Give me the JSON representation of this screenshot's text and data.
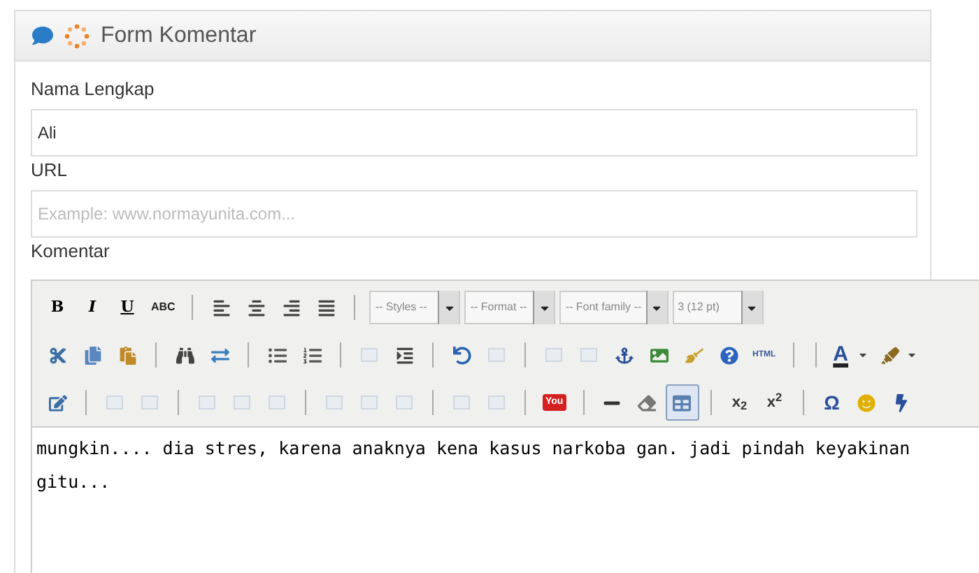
{
  "header": {
    "title": "Form Komentar"
  },
  "fields": [
    {
      "label": "Nama Lengkap",
      "value": "Ali"
    },
    {
      "label": "URL",
      "placeholder": "Example: www.normayunita.com..."
    }
  ],
  "editor": {
    "label": "Komentar",
    "toolbar": [
      [
        {
          "kind": "bold",
          "label": "B",
          "disabled": false,
          "selected": false
        },
        {
          "kind": "italic",
          "label": "I",
          "disabled": false,
          "selected": false
        },
        {
          "kind": "underline",
          "label": "U",
          "disabled": false,
          "selected": false
        },
        {
          "kind": "strike",
          "label": "ABC",
          "disabled": false,
          "selected": false
        },
        {
          "kind": "separator"
        },
        {
          "kind": "align-left",
          "disabled": false,
          "selected": false
        },
        {
          "kind": "align-center",
          "disabled": false,
          "selected": false
        },
        {
          "kind": "align-right",
          "disabled": false,
          "selected": false
        },
        {
          "kind": "align-justify",
          "disabled": false,
          "selected": false
        },
        {
          "kind": "separator"
        },
        {
          "kind": "select",
          "label": "-- Styles --"
        },
        {
          "kind": "select",
          "label": "-- Format --"
        },
        {
          "kind": "select",
          "label": "-- Font family --"
        },
        {
          "kind": "select",
          "label": "3 (12 pt)"
        }
      ],
      [
        {
          "kind": "cut",
          "disabled": false,
          "selected": false
        },
        {
          "kind": "copy",
          "disabled": false,
          "selected": false
        },
        {
          "kind": "paste",
          "disabled": false,
          "selected": false
        },
        {
          "kind": "separator"
        },
        {
          "kind": "find",
          "disabled": false,
          "selected": false
        },
        {
          "kind": "replace",
          "disabled": false,
          "selected": false
        },
        {
          "kind": "separator"
        },
        {
          "kind": "bullet-list",
          "disabled": false,
          "selected": false
        },
        {
          "kind": "number-list",
          "disabled": false,
          "selected": false
        },
        {
          "kind": "separator"
        },
        {
          "kind": "blank",
          "disabled": true,
          "selected": false
        },
        {
          "kind": "indent",
          "disabled": false,
          "selected": false
        },
        {
          "kind": "separator"
        },
        {
          "kind": "undo",
          "disabled": false,
          "selected": false
        },
        {
          "kind": "blank",
          "disabled": true,
          "selected": false
        },
        {
          "kind": "separator"
        },
        {
          "kind": "blank",
          "disabled": true,
          "selected": false
        },
        {
          "kind": "blank",
          "disabled": true,
          "selected": false
        },
        {
          "kind": "anchor",
          "disabled": false,
          "selected": false
        },
        {
          "kind": "image",
          "disabled": false,
          "selected": false
        },
        {
          "kind": "cleanup",
          "disabled": false,
          "selected": false
        },
        {
          "kind": "help",
          "disabled": false,
          "selected": false
        },
        {
          "kind": "html",
          "label": "HTML",
          "disabled": false,
          "selected": false
        },
        {
          "kind": "separator"
        },
        {
          "kind": "separator"
        },
        {
          "kind": "text-color",
          "label": "A",
          "disabled": false,
          "selected": false
        },
        {
          "kind": "highlight",
          "disabled": false,
          "selected": false
        }
      ],
      [
        {
          "kind": "edit",
          "disabled": false,
          "selected": false
        },
        {
          "kind": "separator"
        },
        {
          "kind": "blank",
          "disabled": true,
          "selected": false
        },
        {
          "kind": "blank",
          "disabled": true,
          "selected": false
        },
        {
          "kind": "separator"
        },
        {
          "kind": "blank",
          "disabled": true,
          "selected": false
        },
        {
          "kind": "blank",
          "disabled": true,
          "selected": false
        },
        {
          "kind": "blank",
          "disabled": true,
          "selected": false
        },
        {
          "kind": "separator"
        },
        {
          "kind": "blank",
          "disabled": true,
          "selected": false
        },
        {
          "kind": "blank",
          "disabled": true,
          "selected": false
        },
        {
          "kind": "blank",
          "disabled": true,
          "selected": false
        },
        {
          "kind": "separator"
        },
        {
          "kind": "blank",
          "disabled": true,
          "selected": false
        },
        {
          "kind": "blank",
          "disabled": true,
          "selected": false
        },
        {
          "kind": "separator"
        },
        {
          "kind": "youtube",
          "label": "You",
          "disabled": false,
          "selected": false
        },
        {
          "kind": "separator"
        },
        {
          "kind": "rule",
          "disabled": false,
          "selected": false
        },
        {
          "kind": "eraser",
          "disabled": false,
          "selected": false
        },
        {
          "kind": "table",
          "disabled": false,
          "selected": true
        },
        {
          "kind": "separator"
        },
        {
          "kind": "subscript",
          "label": "x$_{2}$",
          "disabled": false,
          "selected": false
        },
        {
          "kind": "superscript",
          "label": "x$^{2}$",
          "disabled": false,
          "selected": false
        },
        {
          "kind": "separator"
        },
        {
          "kind": "charmap",
          "label": "Ω",
          "disabled": false,
          "selected": false
        },
        {
          "kind": "emoticon",
          "disabled": false,
          "selected": false
        },
        {
          "kind": "flash",
          "disabled": false,
          "selected": false
        }
      ]
    ],
    "content": "mungkin.... dia stres, karena anaknya kena kasus narkoba gan. jadi pindah keyakinan gitu..."
  }
}
